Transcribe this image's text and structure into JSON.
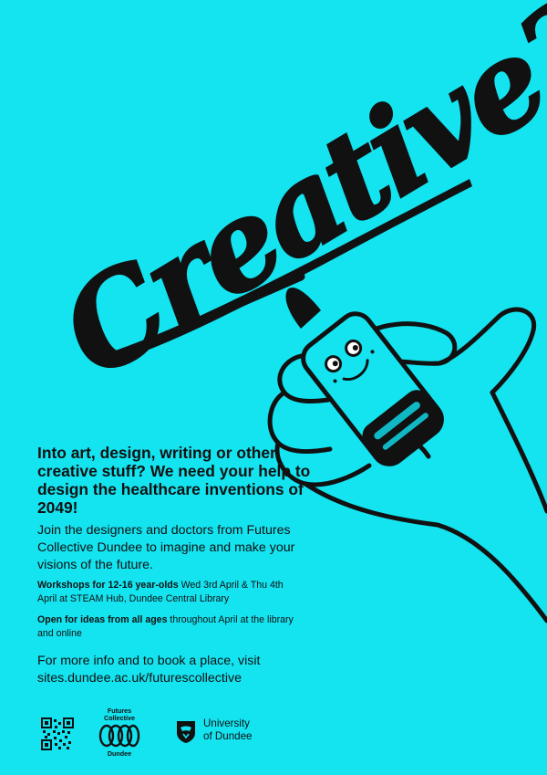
{
  "artwork": {
    "lettering": "Creative?",
    "mascot": "smiling crayon held in a hand"
  },
  "headline": "Into art, design, writing or other creative stuff? We need your help to design the healthcare inventions of 2049!",
  "intro": "Join the designers and doctors from Futures Collective Dundee to imagine and make your visions of the future.",
  "workshops": {
    "bold": "Workshops for 12-16 year-olds",
    "rest": " Wed 3rd April & Thu 4th April at STEAM Hub, Dundee Central Library"
  },
  "open": {
    "bold": "Open for ideas from all ages",
    "rest": " throughout April at the library and online"
  },
  "cta": {
    "line1": "For more info and to book a place, visit",
    "url": "sites.dundee.ac.uk/futurescollective"
  },
  "logos": {
    "qr": "qr-code",
    "futures_collective_top": "Futures Collective",
    "futures_collective_bottom": "Dundee",
    "university_line1": "University",
    "university_line2": "of Dundee"
  },
  "colors": {
    "background": "#14e3f0",
    "ink": "#111111",
    "crayon_highlight": "#0fb8c4"
  }
}
